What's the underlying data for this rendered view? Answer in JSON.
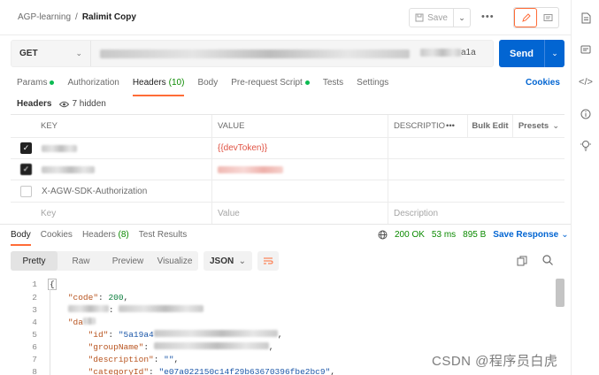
{
  "header": {
    "breadcrumb_parent": "AGP-learning",
    "breadcrumb_sep": "/",
    "breadcrumb_current": "Ralimit Copy",
    "save_label": "Save",
    "more_label": "•••"
  },
  "request": {
    "method": "GET",
    "url_visible_tail": "a1a",
    "send_label": "Send"
  },
  "request_tabs": [
    {
      "label": "Params",
      "count": "",
      "dot": true
    },
    {
      "label": "Authorization",
      "count": "",
      "dot": false
    },
    {
      "label": "Headers",
      "count": "(10)",
      "dot": false,
      "active": true
    },
    {
      "label": "Body",
      "count": "",
      "dot": false
    },
    {
      "label": "Pre-request Script",
      "count": "",
      "dot": true
    },
    {
      "label": "Tests",
      "count": "",
      "dot": false
    },
    {
      "label": "Settings",
      "count": "",
      "dot": false
    }
  ],
  "cookies_label": "Cookies",
  "headers_section": {
    "title": "Headers",
    "hidden_label": "7 hidden"
  },
  "table": {
    "col_key": "KEY",
    "col_value": "VALUE",
    "col_description": "DESCRIPTIO",
    "more": "•••",
    "bulk_edit": "Bulk Edit",
    "presets": "Presets",
    "rows": [
      {
        "key": "",
        "value": "{{devToken}}",
        "checked": true
      },
      {
        "key": "",
        "value": "",
        "checked": true
      },
      {
        "key": "X-AGW-SDK-Authorization",
        "value": "",
        "checked": false
      }
    ],
    "placeholder_key": "Key",
    "placeholder_value": "Value",
    "placeholder_description": "Description"
  },
  "response_tabs": [
    {
      "label": "Body",
      "count": "",
      "active": true
    },
    {
      "label": "Cookies",
      "count": ""
    },
    {
      "label": "Headers",
      "count": "(8)"
    },
    {
      "label": "Test Results",
      "count": ""
    }
  ],
  "response_status": {
    "status": "200 OK",
    "time": "53 ms",
    "size": "895 B",
    "save_response": "Save Response"
  },
  "format_tabs": [
    "Pretty",
    "Raw",
    "Preview",
    "Visualize"
  ],
  "format_active": "Pretty",
  "language": "JSON",
  "code_lines": {
    "n1": "1",
    "n2": "2",
    "n3": "3",
    "n4": "4",
    "n5": "5",
    "n6": "6",
    "n7": "7",
    "n8": "8",
    "l1": "{",
    "l2_key": "\"code\"",
    "l2_val": "200",
    "l4_key": "\"da",
    "l5_key": "\"id\"",
    "l5_val": "\"5a19a4",
    "l6_key": "\"groupName\"",
    "l7_key": "\"description\"",
    "l7_val": "\"\"",
    "l8_key": "\"categoryId\"",
    "l8_val": "\"e07a022150c14f29b63670396fbe2bc9\""
  },
  "watermark": "CSDN @程序员白虎",
  "colors": {
    "accent": "#ff6c37",
    "send": "#0265d2",
    "success": "#0b8a00"
  },
  "icons": [
    "save-icon",
    "pencil-icon",
    "comment-icon",
    "document-icon",
    "chat-icon",
    "code-icon",
    "info-icon",
    "lightbulb-icon",
    "eye-icon",
    "globe-icon",
    "copy-icon",
    "search-icon",
    "wrap-icon"
  ]
}
